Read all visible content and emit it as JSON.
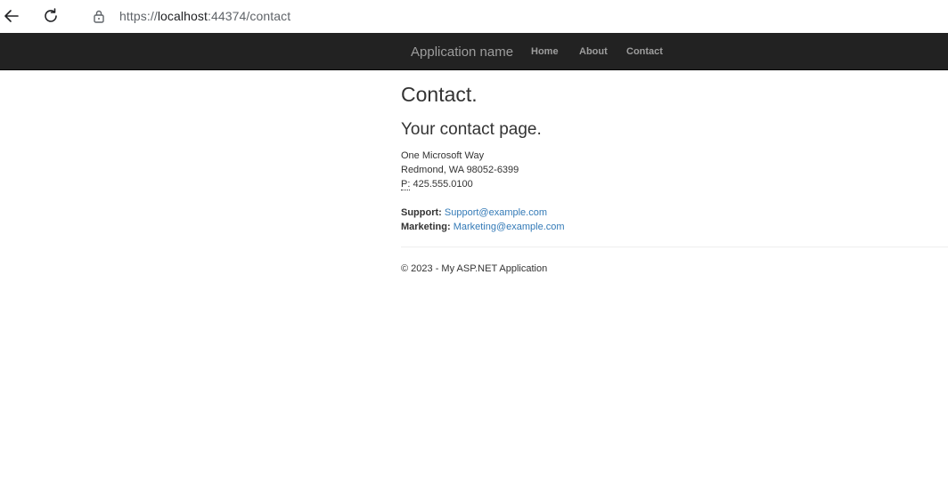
{
  "browser": {
    "url_scheme": "https://",
    "url_host": "localhost",
    "url_rest": ":44374/contact"
  },
  "navbar": {
    "brand": "Application name",
    "links": [
      "Home",
      "About",
      "Contact"
    ]
  },
  "page": {
    "title": "Contact.",
    "subtitle": "Your contact page.",
    "address_line1": "One Microsoft Way",
    "address_line2": "Redmond, WA 98052-6399",
    "phone_abbr": "P:",
    "phone": "425.555.0100",
    "support_label": "Support:",
    "support_email": "Support@example.com",
    "marketing_label": "Marketing:",
    "marketing_email": "Marketing@example.com"
  },
  "footer": {
    "text": "© 2023 - My ASP.NET Application"
  },
  "colors": {
    "navbar_bg": "#222222",
    "nav_text": "#9d9d9d",
    "link": "#337ab7",
    "body_text": "#333333"
  }
}
